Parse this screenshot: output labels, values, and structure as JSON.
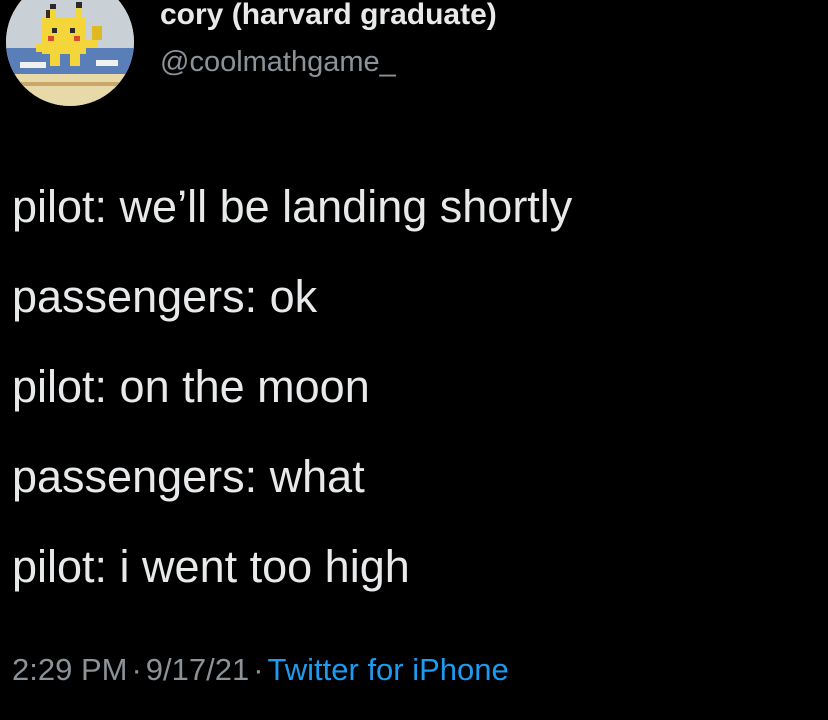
{
  "author": {
    "display_name": "cory (harvard graduate)",
    "handle": "@coolmathgame_",
    "avatar_icon": "pixel-pikachu-avatar-icon"
  },
  "tweet": {
    "lines": [
      "pilot: we’ll be landing shortly",
      "passengers: ok",
      "pilot: on the moon",
      "passengers: what",
      "pilot: i went too high"
    ]
  },
  "meta": {
    "time": "2:29 PM",
    "separator": "·",
    "date": "9/17/21",
    "source": "Twitter for iPhone"
  },
  "colors": {
    "background": "#000000",
    "text": "#e7e9ea",
    "secondary_text": "#8b9298",
    "link": "#1d9bf0"
  }
}
